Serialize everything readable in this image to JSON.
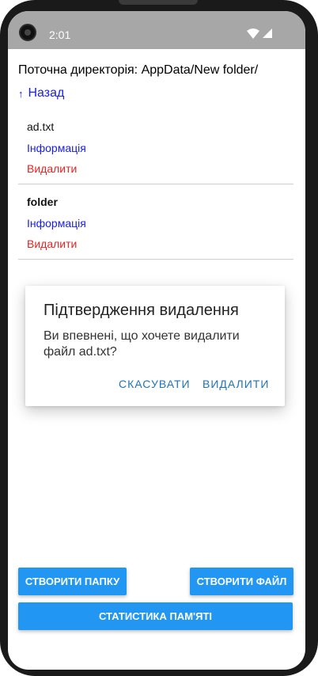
{
  "statusbar": {
    "time": "2:01"
  },
  "header": {
    "current_dir": "Поточна директорія: AppData/New folder/",
    "back_label": "Назад"
  },
  "items": [
    {
      "name": "ad.txt",
      "info": "Інформація",
      "delete": "Видалити"
    },
    {
      "name": "folder",
      "info": "Інформація",
      "delete": "Видалити"
    }
  ],
  "dialog": {
    "title": "Підтвердження видалення",
    "message": "Ви впевнені, що хочете видалити файл ad.txt?",
    "cancel": "СКАСУВАТИ",
    "confirm": "ВИДАЛИТИ"
  },
  "buttons": {
    "create_folder": "СТВОРИТИ ПАПКУ",
    "create_file": "СТВОРИТИ ФАЙЛ",
    "memory_stats": "СТАТИСТИКА ПАМ'ЯТІ"
  },
  "colors": {
    "accent": "#2196f3",
    "link": "#1a20e8",
    "danger": "#e52222"
  }
}
